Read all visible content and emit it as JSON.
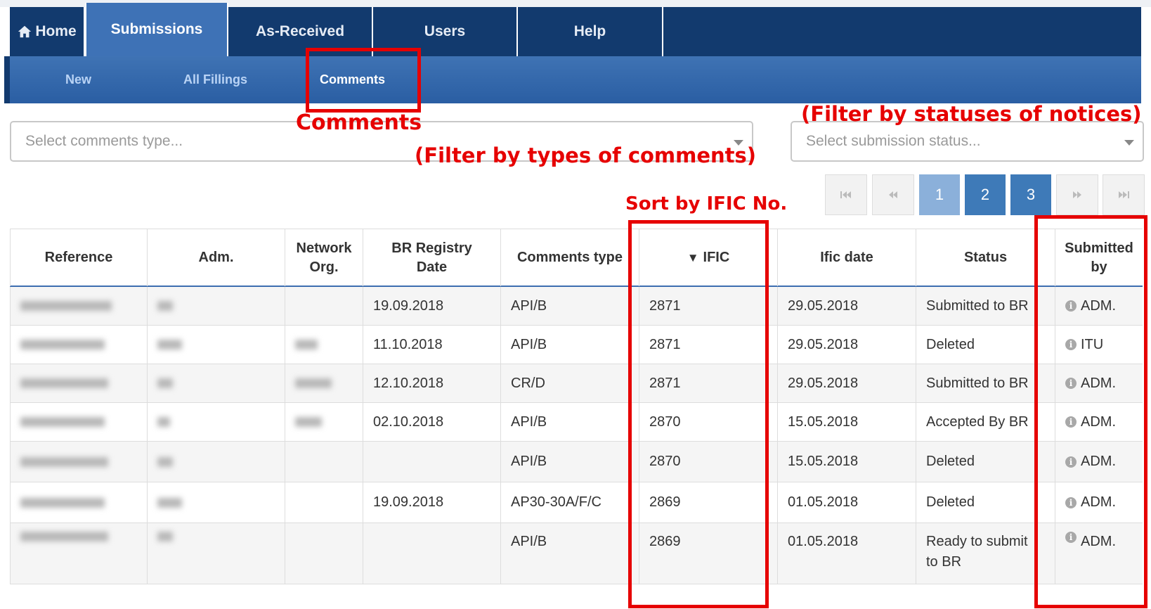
{
  "main_nav": {
    "home": "Home",
    "submissions": "Submissions",
    "as_received": "As-Received",
    "users": "Users",
    "help": "Help"
  },
  "sub_nav": {
    "new": "New",
    "all_fillings": "All Fillings",
    "comments": "Comments"
  },
  "filters": {
    "comments_type_placeholder": "Select comments type...",
    "status_placeholder": "Select submission status..."
  },
  "pagination": {
    "first_icon": "first-page-icon",
    "prev_icon": "prev-page-icon",
    "pages": [
      "1",
      "2",
      "3"
    ],
    "current_page": "1",
    "next_icon": "next-page-icon",
    "last_icon": "last-page-icon"
  },
  "table": {
    "headers": {
      "reference": "Reference",
      "adm": "Adm.",
      "network_org_1": "Network",
      "network_org_2": "Org.",
      "br_date_1": "BR Registry",
      "br_date_2": "Date",
      "comments_type": "Comments type",
      "ific_arrow": "▼",
      "ific": "IFIC",
      "ific_date": "Ific date",
      "status": "Status",
      "submitted_1": "Submitted",
      "submitted_2": "by"
    },
    "rows": [
      {
        "br_date": "19.09.2018",
        "type": "API/B",
        "ific": "2871",
        "ific_date": "29.05.2018",
        "status": "Submitted to BR",
        "status2": "",
        "by": "ADM."
      },
      {
        "br_date": "11.10.2018",
        "type": "API/B",
        "ific": "2871",
        "ific_date": "29.05.2018",
        "status": "Deleted",
        "status2": "",
        "by": "ITU"
      },
      {
        "br_date": "12.10.2018",
        "type": "CR/D",
        "ific": "2871",
        "ific_date": "29.05.2018",
        "status": "Submitted to BR",
        "status2": "",
        "by": "ADM."
      },
      {
        "br_date": "02.10.2018",
        "type": "API/B",
        "ific": "2870",
        "ific_date": "15.05.2018",
        "status": "Accepted By BR",
        "status2": "",
        "by": "ADM."
      },
      {
        "br_date": "",
        "type": "API/B",
        "ific": "2870",
        "ific_date": "15.05.2018",
        "status": "Deleted",
        "status2": "",
        "by": "ADM."
      },
      {
        "br_date": "19.09.2018",
        "type": "AP30-30A/F/C",
        "ific": "2869",
        "ific_date": "01.05.2018",
        "status": "Deleted",
        "status2": "",
        "by": "ADM."
      },
      {
        "br_date": "",
        "type": "API/B",
        "ific": "2869",
        "ific_date": "01.05.2018",
        "status": "Ready to submit",
        "status2": "to BR",
        "by": "ADM."
      }
    ]
  },
  "annotations": {
    "comments_label": "Comments",
    "filter_statuses": "(Filter by statuses of notices)",
    "filter_types": "(Filter by types of comments)",
    "sort_ific": "Sort by IFIC No.",
    "color": "#e60000"
  },
  "colors": {
    "nav_dark": "#123a6e",
    "nav_active": "#3e72b6",
    "page_button": "#3e7ab8",
    "page_current": "#8bb0da"
  }
}
